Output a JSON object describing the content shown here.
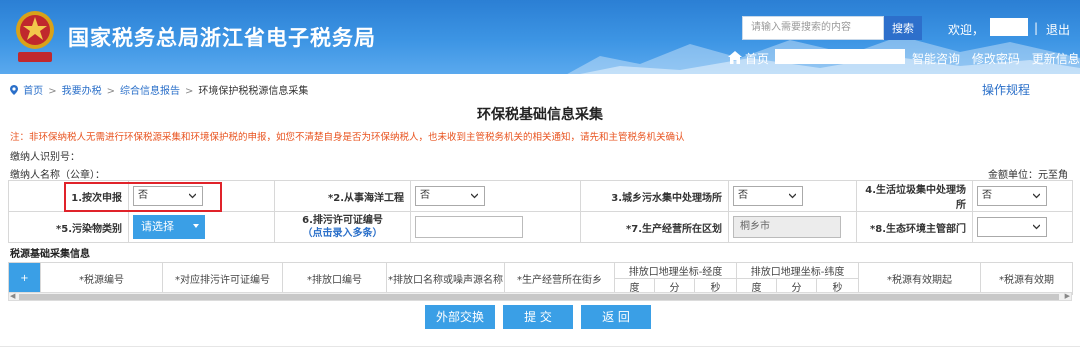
{
  "header": {
    "title": "国家税务总局浙江省电子税务局",
    "search_placeholder": "请输入需要搜索的内容",
    "search_button": "搜索",
    "welcome": "欢迎，",
    "separator": "|",
    "logout": "退出",
    "home": "首页",
    "nav_links": [
      "智能咨询",
      "修改密码",
      "更新信息"
    ],
    "emblem_caption": "中国税务"
  },
  "breadcrumb": {
    "items": [
      "首页",
      "我要办税",
      "综合信息报告",
      "环境保护税税源信息采集"
    ],
    "arrow": ">"
  },
  "operation_guide": "操作规程",
  "page_title": "环保税基础信息采集",
  "notice": "注：非环保纳税人无需进行环保税源采集和环境保护税的申报，如您不清楚自身是否为环保纳税人，也未收到主管税务机关的相关通知，请先和主管税务机关确认",
  "taxpayer": {
    "id_label": "缴纳人识别号：",
    "name_label": "缴纳人名称（公章）：",
    "amount_unit": "金额单位：元至角"
  },
  "form": {
    "row1": [
      {
        "label": "1.按次申报",
        "value": "否"
      },
      {
        "label": "*2.从事海洋工程",
        "value": "否"
      },
      {
        "label": "3.城乡污水集中处理场所",
        "value": "否"
      },
      {
        "label": "4.生活垃圾集中处理场所",
        "value": "否"
      }
    ],
    "row2": {
      "pollutant_label": "*5.污染物类别",
      "pollutant_button": "请选择",
      "permit_label": "6.排污许可证编号",
      "permit_sub": "（点击录入多条）",
      "district_label": "*7.生产经营所在区划",
      "district_value": "桐乡市",
      "authority_label": "*8.生态环境主管部门",
      "authority_value": ""
    }
  },
  "section_title": "税源基础采集信息",
  "grid": {
    "add": "+",
    "columns": [
      "*税源编号",
      "*对应排污许可证编号",
      "*排放口编号",
      "*排放口名称或噪声源名称",
      "*生产经营所在街乡"
    ],
    "lng_header": "排放口地理坐标-经度",
    "lat_header": "排放口地理坐标-纬度",
    "coord_sub": [
      "度",
      "分",
      "秒"
    ],
    "col_valid_from": "*税源有效期起",
    "col_valid_to": "*税源有效期"
  },
  "buttons": {
    "exchange": "外部交换",
    "submit": "提 交",
    "back": "返 回"
  },
  "colors": {
    "header_blue": "#3d95e4",
    "accent_blue": "#3a9fe6",
    "notice_orange": "#e8531f",
    "highlight_red": "#e0232a"
  }
}
